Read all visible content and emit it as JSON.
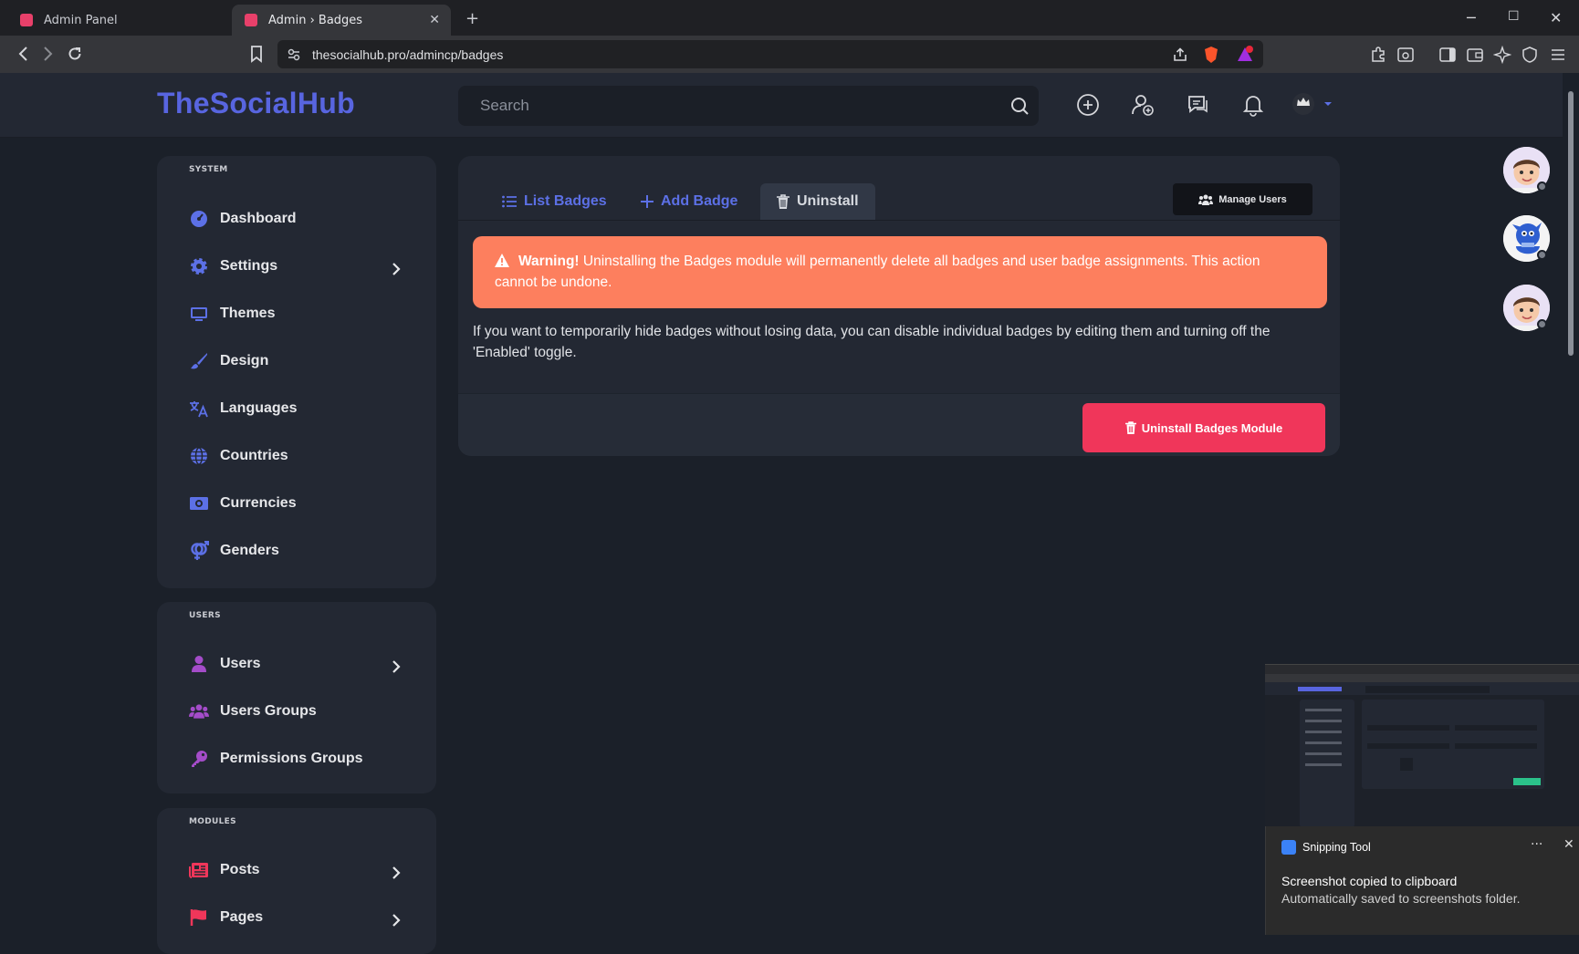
{
  "browser": {
    "tabs": [
      {
        "title": "Admin Panel"
      },
      {
        "title": "Admin › Badges"
      }
    ],
    "url": "thesocialhub.pro/admincp/badges"
  },
  "header": {
    "logo": "TheSocialHub",
    "search_placeholder": "Search"
  },
  "sidebar": {
    "system": {
      "title": "SYSTEM",
      "items": [
        {
          "label": "Dashboard",
          "icon": "dashboard-icon",
          "color": "#5c70e6"
        },
        {
          "label": "Settings",
          "icon": "gear-icon",
          "color": "#5c70e6"
        },
        {
          "label": "Themes",
          "icon": "monitor-icon",
          "color": "#5c70e6"
        },
        {
          "label": "Design",
          "icon": "brush-icon",
          "color": "#5c70e6"
        },
        {
          "label": "Languages",
          "icon": "language-icon",
          "color": "#5c70e6"
        },
        {
          "label": "Countries",
          "icon": "globe-icon",
          "color": "#5c70e6"
        },
        {
          "label": "Currencies",
          "icon": "money-icon",
          "color": "#5c70e6"
        },
        {
          "label": "Genders",
          "icon": "gender-icon",
          "color": "#5c70e6"
        }
      ]
    },
    "users": {
      "title": "USERS",
      "items": [
        {
          "label": "Users",
          "icon": "user-icon",
          "color": "#a44cc9"
        },
        {
          "label": "Users Groups",
          "icon": "users-icon",
          "color": "#a44cc9"
        },
        {
          "label": "Permissions Groups",
          "icon": "key-icon",
          "color": "#a44cc9"
        }
      ]
    },
    "modules": {
      "title": "MODULES",
      "items": [
        {
          "label": "Posts",
          "icon": "newspaper-icon",
          "color": "#f0365a"
        },
        {
          "label": "Pages",
          "icon": "flag-icon",
          "color": "#f0365a"
        }
      ]
    }
  },
  "main": {
    "tabs": [
      {
        "label": "List Badges"
      },
      {
        "label": "Add Badge"
      },
      {
        "label": "Uninstall"
      }
    ],
    "manage_users_label": "Manage Users",
    "warning_title": "Warning!",
    "warning_text": " Uninstalling the Badges module will permanently delete all badges and user badge assignments. This action cannot be undone.",
    "info_text": "If you want to temporarily hide badges without losing data, you can disable individual badges by editing them and turning off the 'Enabled' toggle.",
    "uninstall_button": "Uninstall Badges Module"
  },
  "toast": {
    "app_name": "Snipping Tool",
    "title": "Screenshot copied to clipboard",
    "subtitle": "Automatically saved to screenshots folder."
  },
  "colors": {
    "accent": "#5865e0",
    "warning": "#fd7f5e",
    "danger": "#f0365a"
  }
}
